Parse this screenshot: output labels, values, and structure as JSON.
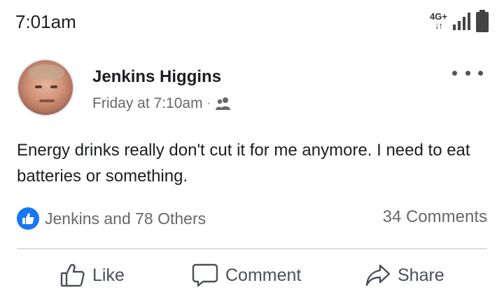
{
  "status_bar": {
    "time": "7:01am",
    "network": "4G+",
    "network_arrows": "↓↑"
  },
  "post": {
    "author": "Jenkins Higgins",
    "timestamp": "Friday at 7:10am",
    "separator": "·",
    "audience_icon": "friends-icon",
    "text": "Energy drinks really don't cut it for me anymore. I need to eat batteries or something.",
    "reactions_summary": "Jenkins and 78 Others",
    "comments_count_label": "34 Comments"
  },
  "actions": {
    "like_label": "Like",
    "comment_label": "Comment",
    "share_label": "Share"
  },
  "colors": {
    "accent": "#1877f2",
    "secondary_text": "#65676b",
    "divider": "#dadde1"
  }
}
